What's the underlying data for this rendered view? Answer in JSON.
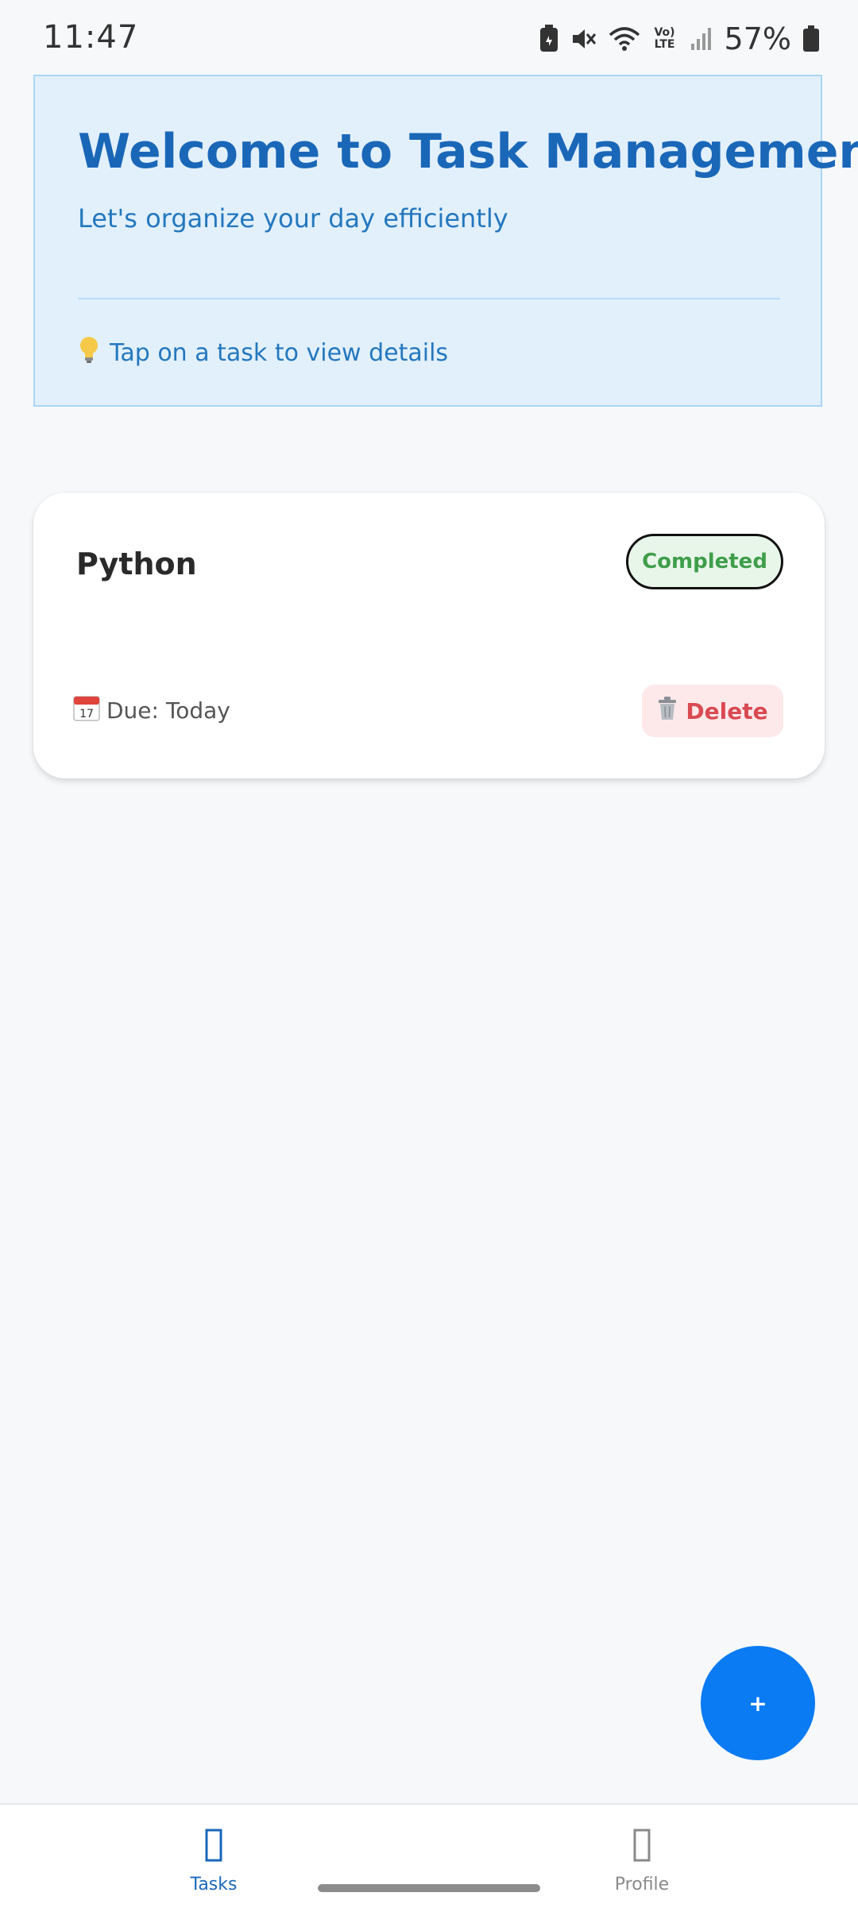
{
  "status_bar": {
    "time": "11:47",
    "battery": "57%",
    "volte_label": "Vo) LTE",
    "icons": [
      "battery-saver-icon",
      "mute-icon",
      "wifi-icon",
      "volte-icon",
      "signal-icon",
      "battery-icon"
    ]
  },
  "welcome": {
    "title": "Welcome to Task Management",
    "subtitle": "Let's organize your day efficiently",
    "hint": "Tap on a task to view details",
    "hint_icon": "lightbulb-icon"
  },
  "tasks": [
    {
      "title": "Python",
      "status": "Completed",
      "due": "Due: Today",
      "delete_label": "Delete"
    }
  ],
  "fab": {
    "label": "+"
  },
  "bottom_nav": {
    "items": [
      {
        "label": "Tasks",
        "active": true,
        "icon": "tasks-icon"
      },
      {
        "label": "Profile",
        "active": false,
        "icon": "profile-icon"
      }
    ]
  },
  "colors": {
    "accent": "#0a7bf2",
    "welcome_bg": "#e2f0fc",
    "title_blue": "#1a67b8",
    "completed_green": "#3f9e4a",
    "delete_red": "#d94a52"
  }
}
